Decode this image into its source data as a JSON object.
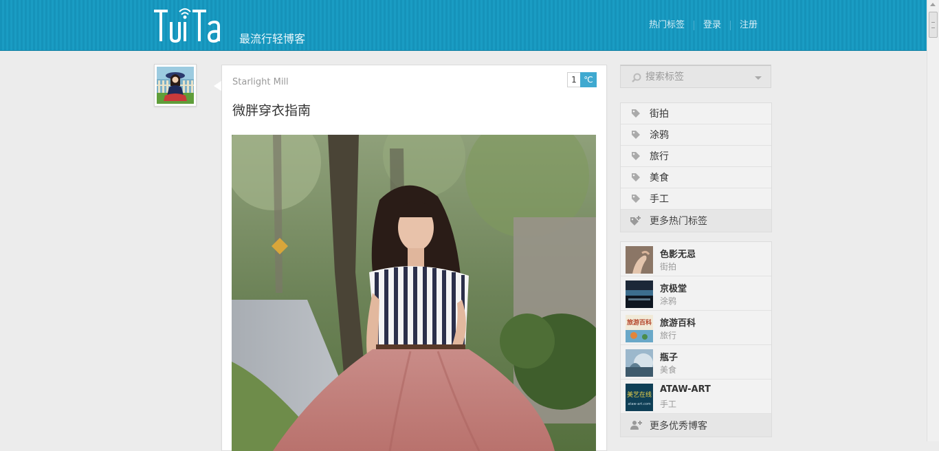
{
  "header": {
    "logo_text": "TuiTa",
    "tagline": "最流行轻博客",
    "nav": [
      "热门标签",
      "登录",
      "注册"
    ]
  },
  "post": {
    "author": "Starlight Mill",
    "title": "微胖穿衣指南",
    "hot_count": "1",
    "hot_unit": "℃"
  },
  "sidebar": {
    "search_placeholder": "搜索标签",
    "tags": [
      "街拍",
      "涂鸦",
      "旅行",
      "美食",
      "手工"
    ],
    "tags_more": "更多热门标签",
    "blogs": [
      {
        "name": "色影无忌",
        "category": "街拍"
      },
      {
        "name": "京极堂",
        "category": "涂鸦"
      },
      {
        "name": "旅游百科",
        "category": "旅行",
        "thumb_text": "旅游百科"
      },
      {
        "name": "瓶子",
        "category": "美食"
      },
      {
        "name": "ATAW-ART",
        "category": "手工",
        "thumb_text": "美艺在线",
        "thumb_sub": "ataw-art.com"
      }
    ],
    "blogs_more": "更多优秀博客"
  },
  "colors": {
    "header_bg": "#1593ba",
    "accent": "#3fa9d0",
    "page_bg": "#ececec"
  }
}
